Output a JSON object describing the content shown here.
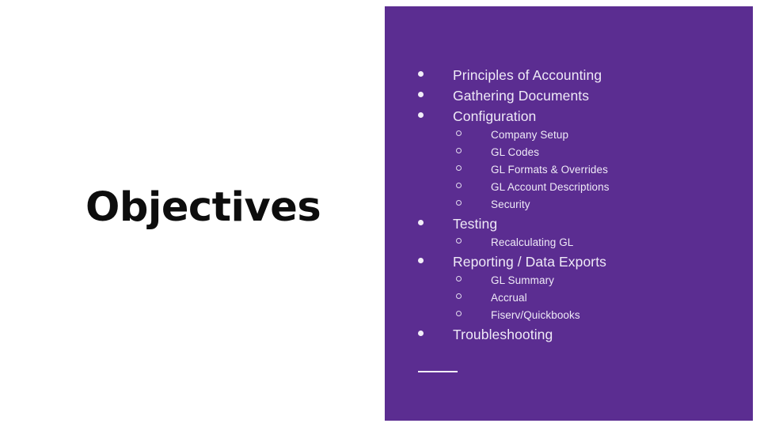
{
  "slide": {
    "title": "Objectives",
    "background_color": "#ffffff",
    "panel_color": "#5b2d91",
    "text_color": "#efeaf7",
    "title_color": "#0d0d0d"
  },
  "outline": {
    "items": [
      {
        "level": 1,
        "text": "Principles of Accounting",
        "marker": "filled-bullet"
      },
      {
        "level": 1,
        "text": "Gathering Documents",
        "marker": "filled-bullet"
      },
      {
        "level": 1,
        "text": "Configuration",
        "marker": "filled-bullet"
      },
      {
        "level": 2,
        "text": "Company Setup",
        "marker": "hollow-bullet"
      },
      {
        "level": 2,
        "text": "GL Codes",
        "marker": "hollow-bullet"
      },
      {
        "level": 2,
        "text": "GL Formats & Overrides",
        "marker": "hollow-bullet"
      },
      {
        "level": 2,
        "text": "GL Account Descriptions",
        "marker": "hollow-bullet"
      },
      {
        "level": 2,
        "text": "Security",
        "marker": "hollow-bullet"
      },
      {
        "level": 1,
        "text": "Testing",
        "marker": "filled-bullet"
      },
      {
        "level": 2,
        "text": "Recalculating GL",
        "marker": "hollow-bullet"
      },
      {
        "level": 1,
        "text": "Reporting / Data Exports",
        "marker": "filled-bullet"
      },
      {
        "level": 2,
        "text": "GL Summary",
        "marker": "hollow-bullet"
      },
      {
        "level": 2,
        "text": "Accrual",
        "marker": "hollow-bullet"
      },
      {
        "level": 2,
        "text": "Fiserv/Quickbooks",
        "marker": "hollow-bullet"
      },
      {
        "level": 1,
        "text": "Troubleshooting",
        "marker": "filled-bullet"
      }
    ]
  },
  "divider": {
    "name": "accent-rule"
  }
}
